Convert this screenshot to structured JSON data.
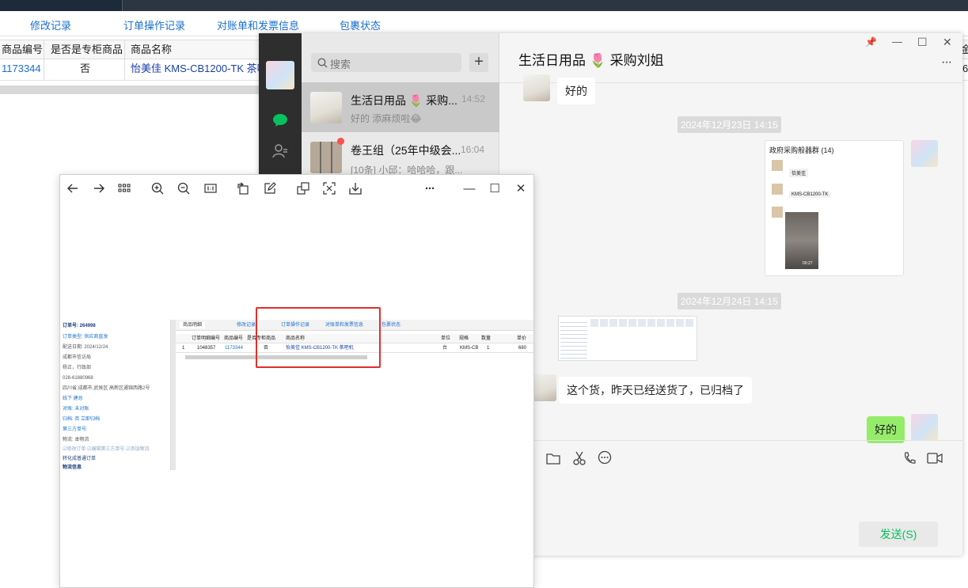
{
  "app": {
    "tabs": [
      "修改记录",
      "订单操作记录",
      "对账单和发票信息",
      "包裹状态"
    ],
    "grid_headers": [
      "商品编号",
      "是否是专柜商品",
      "商品名称"
    ],
    "grid_row": {
      "code": "1173344",
      "is_counter": "否",
      "name": "怡美佳 KMS-CB1200-TK 茶吧"
    },
    "right_edge_header": "金",
    "right_edge_value": "6"
  },
  "wechat": {
    "search_placeholder": "搜索",
    "add_symbol": "+",
    "chats": [
      {
        "title": "生活日用品 🌷 采购...",
        "time": "14:52",
        "preview": "好的  添麻烦啦😂"
      },
      {
        "title": "卷王组（25年中级会...",
        "time": "16:04",
        "preview": "[10条] 小邱：哈哈哈，跟..."
      }
    ],
    "chat_title": "生活日用品 🌷 采购刘姐",
    "window_controls": [
      "📌",
      "—",
      "☐",
      "✕"
    ],
    "more": "···",
    "messages": {
      "m1": "好的",
      "time1": "2024年12月23日 14:15",
      "forward_title": "政府采购般器群 (14)",
      "forward_items": [
        "恰美佳",
        "KMS-CB1200-TK"
      ],
      "video_duration": "00:27",
      "time2": "2024年12月24日 14:15",
      "m2": "这个货，昨天已经送货了，已归档了",
      "m3": "好的"
    },
    "send_label": "发送(S)"
  },
  "viewer": {
    "controls": [
      "—",
      "☐",
      "✕"
    ],
    "more": "···",
    "shot": {
      "order_no": "订单号: 264998",
      "left_lines": [
        "订单类型: 供应商直发",
        "配送日期: 2024/12/24",
        "成都市信访局",
        "杨正，行政部",
        "028-61880968",
        "四川省,成都市,武侯区 高新区通锦西路2号",
        "线下 建总",
        "对账: 未对账",
        "归档: 否 立即归档",
        "第三方单号:",
        "物流: 本物流"
      ],
      "left_buttons": "☑修改订单  ☑编辑第三方单号  ☑添加物流",
      "left_link": "转化成普通订单",
      "left_footer": "物流信息",
      "tabs": [
        "商品明细",
        "修改记录",
        "订单操作记录",
        "对账单和发票信息",
        "包裹状态"
      ],
      "headers": [
        "订单明细编号",
        "商品编号",
        "是否专柜商品",
        "商品名称",
        "单位",
        "规格",
        "数量",
        "单价"
      ],
      "row": [
        "1",
        "1048357",
        "1173344",
        "否",
        "怡美佳 KMS-CB1200-TK 茶吧机",
        "台",
        "KMS-CB",
        "1",
        "680"
      ]
    }
  },
  "colors": {
    "link": "#1a6fd0",
    "wechat_green": "#95ec69",
    "send_text": "#07c160",
    "annotation": "#e0302a"
  }
}
